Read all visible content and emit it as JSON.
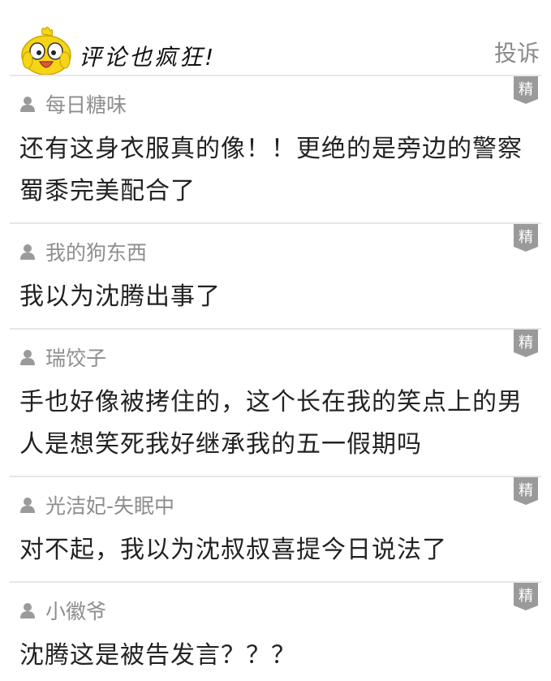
{
  "header": {
    "title": "评论也疯狂!",
    "report_label": "投诉"
  },
  "badge_label": "精",
  "colors": {
    "badge_bg": "#9a9a9a",
    "username": "#8e8e8e",
    "text": "#222222",
    "divider": "#e6e6e6",
    "mascot_yellow": "#f6d418"
  },
  "comments": [
    {
      "user": "每日糖味",
      "text": "还有这身衣服真的像！！更绝的是旁边的警察蜀黍完美配合了"
    },
    {
      "user": "我的狗东西",
      "text": "我以为沈腾出事了"
    },
    {
      "user": "瑞饺子",
      "text": "手也好像被拷住的，这个长在我的笑点上的男人是想笑死我好继承我的五一假期吗"
    },
    {
      "user": "光洁妃-失眠中",
      "text": "对不起，我以为沈叔叔喜提今日说法了"
    },
    {
      "user": "小徽爷",
      "text": "沈腾这是被告发言？？？"
    }
  ]
}
